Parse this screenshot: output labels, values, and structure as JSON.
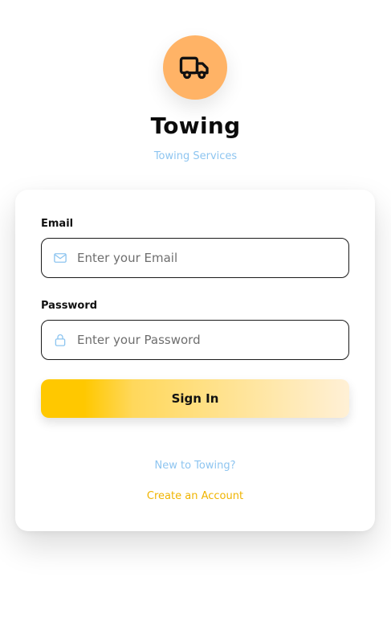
{
  "brand": {
    "title": "Towing",
    "subtitle": "Towing Services",
    "logo_icon": "truck-icon",
    "logo_bg": "#ffb366"
  },
  "form": {
    "email": {
      "label": "Email",
      "placeholder": "Enter your Email",
      "value": "",
      "icon": "mail-icon"
    },
    "password": {
      "label": "Password",
      "placeholder": "Enter your Password",
      "value": "",
      "icon": "lock-icon"
    },
    "submit_label": "Sign In"
  },
  "footer": {
    "prompt": "New to Towing?",
    "link_label": "Create an Account"
  },
  "colors": {
    "accent_yellow": "#ffc800",
    "link_blue": "#8ec5f0",
    "link_yellow": "#f0b400"
  }
}
